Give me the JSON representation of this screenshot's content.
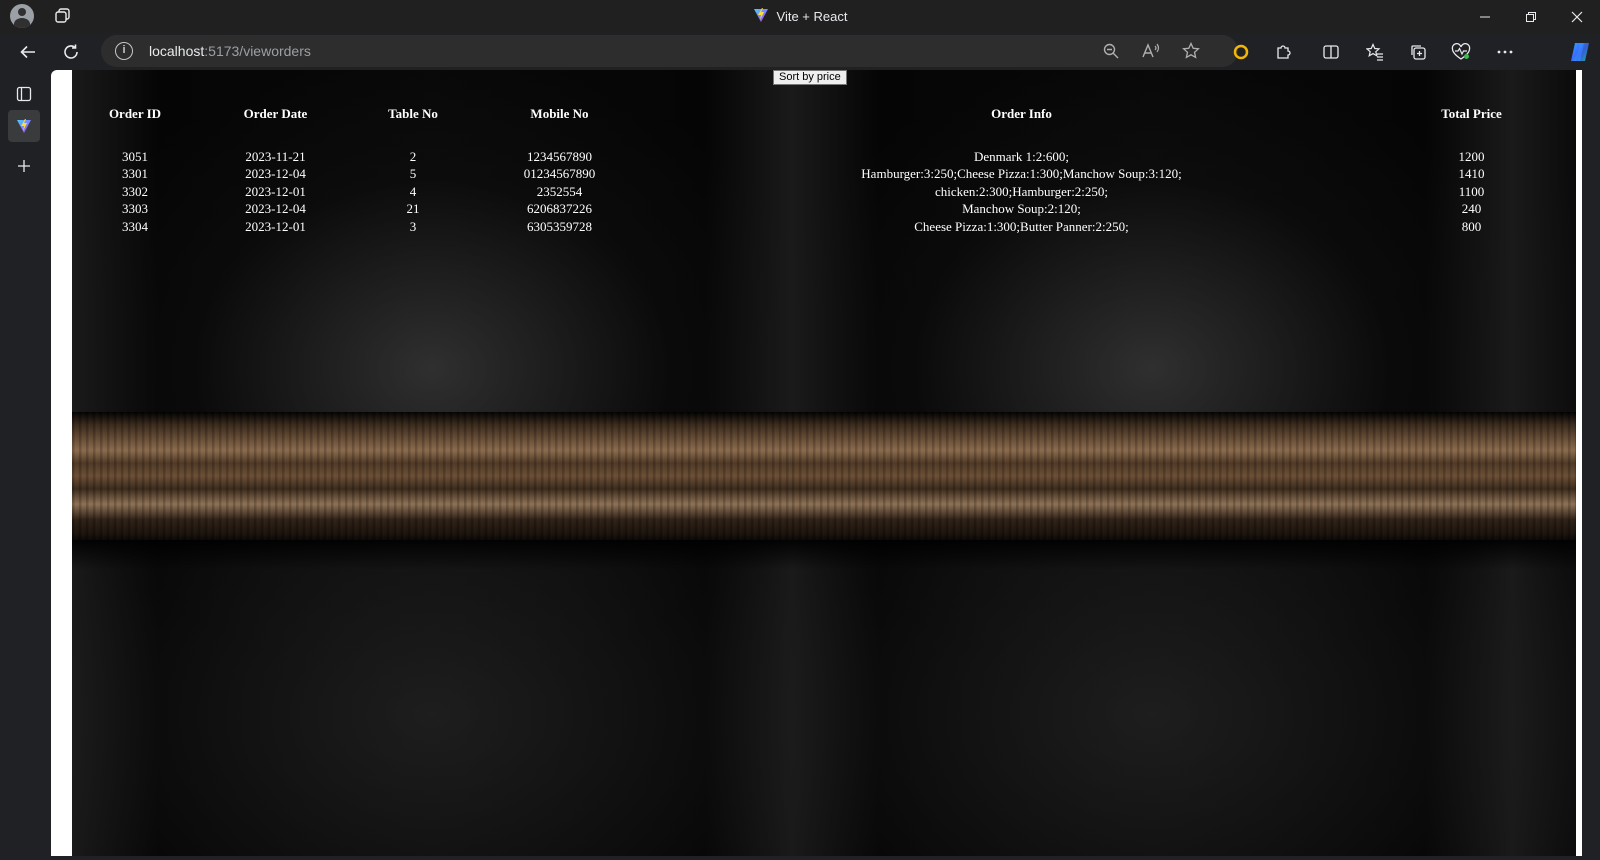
{
  "browser": {
    "window_title": "Vite + React",
    "url_host": "localhost",
    "url_rest": ":5173/vieworders"
  },
  "page": {
    "sort_button_label": "Sort by price",
    "columns": [
      "Order ID",
      "Order Date",
      "Table No",
      "Mobile No",
      "Order Info",
      "Total Price"
    ],
    "rows": [
      {
        "order_id": "3051",
        "order_date": "2023-11-21",
        "table_no": "2",
        "mobile_no": "1234567890",
        "order_info": "Denmark 1:2:600;",
        "total_price": "1200"
      },
      {
        "order_id": "3301",
        "order_date": "2023-12-04",
        "table_no": "5",
        "mobile_no": "01234567890",
        "order_info": "Hamburger:3:250;Cheese Pizza:1:300;Manchow Soup:3:120;",
        "total_price": "1410"
      },
      {
        "order_id": "3302",
        "order_date": "2023-12-01",
        "table_no": "4",
        "mobile_no": "2352554",
        "order_info": "chicken:2:300;Hamburger:2:250;",
        "total_price": "1100"
      },
      {
        "order_id": "3303",
        "order_date": "2023-12-04",
        "table_no": "21",
        "mobile_no": "6206837226",
        "order_info": "Manchow Soup:2:120;",
        "total_price": "240"
      },
      {
        "order_id": "3304",
        "order_date": "2023-12-01",
        "table_no": "3",
        "mobile_no": "6305359728",
        "order_info": "Cheese Pizza:1:300;Butter Panner:2:250;",
        "total_price": "800"
      }
    ]
  }
}
